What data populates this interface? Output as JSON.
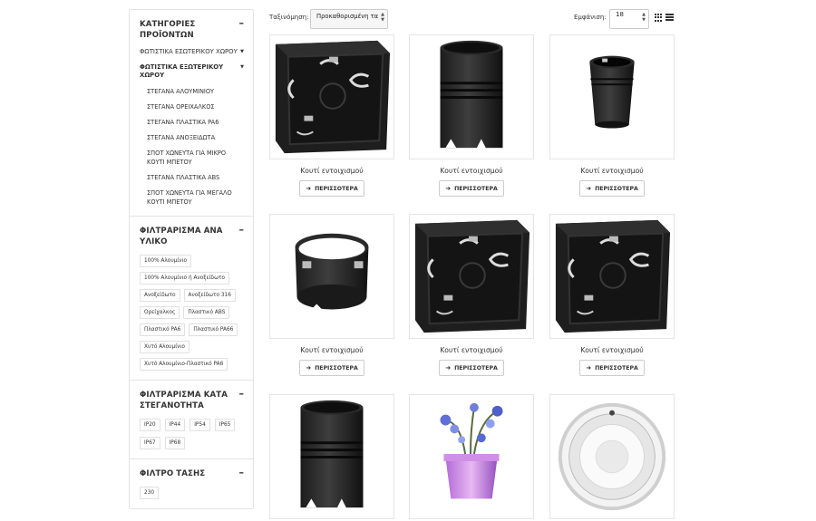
{
  "sidebar": {
    "categories": {
      "title": "ΚΑΤΗΓΟΡΙΕΣ ΠΡΟΪΟΝΤΩΝ",
      "items": [
        {
          "label": "ΦΩΤΙΣΤΙΚΑ ΕΣΩΤΕΡΙΚΟΥ ΧΩΡΟΥ"
        },
        {
          "label": "ΦΩΤΙΣΤΙΚΑ ΕΞΩΤΕΡΙΚΟΥ ΧΩΡΟΥ"
        }
      ],
      "subitems": [
        "ΣΤΕΓΑΝΑ ΑΛΟΥΜΙΝΙΟΥ",
        "ΣΤΕΓΑΝΑ ΟΡΕΙΧΑΛΚΟΣ",
        "ΣΤΕΓΑΝΑ ΠΛΑΣΤΙΚΑ PA6",
        "ΣΤΕΓΑΝΑ ΑΝΟΞΕΙΔΩΤΑ",
        "ΣΠΟΤ ΧΩΝΕΥΤΑ ΓΙΑ ΜΙΚΡΟ ΚΟΥΤΙ ΜΠΕΤΟΥ",
        "ΣΤΕΓΑΝΑ ΠΛΑΣΤΙΚΑ ABS",
        "ΣΠΟΤ ΧΩΝΕΥΤΑ ΓΙΑ ΜΕΓΑΛΟ ΚΟΥΤΙ ΜΠΕΤΟΥ"
      ]
    },
    "material_filter": {
      "title": "ΦΙΛΤΡΑΡΙΣΜΑ ΑΝΑ ΥΛΙΚΟ",
      "tags": [
        "100% Αλουμίνιο",
        "100% Αλουμίνιο ή Ανοξείδωτο",
        "Ανοξείδωτο",
        "Ανοξείδωτο 316",
        "Ορείχαλκος",
        "Πλαστικό ABS",
        "Πλαστικό PA6",
        "Πλαστικό PA66",
        "Χυτό Αλουμίνιο",
        "Χυτό Αλουμίνιο-Πλαστικό PA6"
      ]
    },
    "ip_filter": {
      "title": "ΦΙΛΤΡΑΡΙΣΜΑ ΚΑΤΑ ΣΤΕΓΑΝΟΤΗΤΑ",
      "tags": [
        "IP20",
        "IP44",
        "IP54",
        "IP65",
        "IP67",
        "IP68"
      ]
    },
    "voltage_filter": {
      "title": "ΦΙΛΤΡΟ ΤΑΣΗΣ",
      "tags": [
        "230"
      ]
    }
  },
  "toolbar": {
    "sort_label": "Ταξινόμηση:",
    "sort_value": "Προκαθορισμένη τα",
    "show_label": "Εμφάνιση:",
    "show_value": "18"
  },
  "products": [
    {
      "name": "Κουτί εντοιχισμού",
      "button": "ΠΕΡΙΣΣΟΤΕΡΑ",
      "image": "square-box"
    },
    {
      "name": "Κουτί εντοιχισμού",
      "button": "ΠΕΡΙΣΣΟΤΕΡΑ",
      "image": "cylinder-tall"
    },
    {
      "name": "Κουτί εντοιχισμού",
      "button": "ΠΕΡΙΣΣΟΤΕΡΑ",
      "image": "cylinder-small"
    },
    {
      "name": "Κουτί εντοιχισμού",
      "button": "ΠΕΡΙΣΣΟΤΕΡΑ",
      "image": "ring"
    },
    {
      "name": "Κουτί εντοιχισμού",
      "button": "ΠΕΡΙΣΣΟΤΕΡΑ",
      "image": "square-box"
    },
    {
      "name": "Κουτί εντοιχισμού",
      "button": "ΠΕΡΙΣΣΟΤΕΡΑ",
      "image": "square-box"
    },
    {
      "name": "",
      "button": "",
      "image": "cylinder-tall"
    },
    {
      "name": "",
      "button": "",
      "image": "flower-pot"
    },
    {
      "name": "",
      "button": "",
      "image": "pool-light"
    }
  ]
}
